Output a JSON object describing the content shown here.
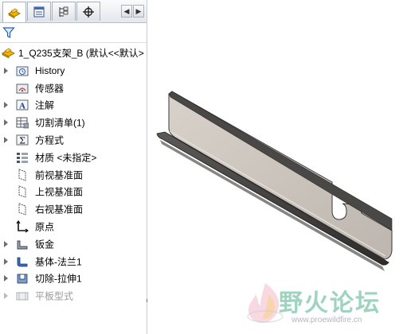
{
  "tree": {
    "root": {
      "label": "1_Q235支架_B  (默认<<默认>"
    },
    "items": [
      {
        "label": "History",
        "icon": "history-folder-icon",
        "expandable": true
      },
      {
        "label": "传感器",
        "icon": "sensor-folder-icon",
        "expandable": false
      },
      {
        "label": "注解",
        "icon": "annotation-icon",
        "expandable": true
      },
      {
        "label": "切割清单(1)",
        "icon": "cut-list-icon",
        "expandable": true
      },
      {
        "label": "方程式",
        "icon": "equation-icon",
        "expandable": true
      },
      {
        "label": "材质 <未指定>",
        "icon": "material-icon",
        "expandable": false
      },
      {
        "label": "前视基准面",
        "icon": "plane-icon",
        "expandable": false
      },
      {
        "label": "上视基准面",
        "icon": "plane-icon",
        "expandable": false
      },
      {
        "label": "右视基准面",
        "icon": "plane-icon",
        "expandable": false
      },
      {
        "label": "原点",
        "icon": "origin-icon",
        "expandable": false
      },
      {
        "label": "钣金",
        "icon": "sheet-metal-icon",
        "expandable": true
      },
      {
        "label": "基体-法兰1",
        "icon": "base-flange-icon",
        "expandable": true
      },
      {
        "label": "切除-拉伸1",
        "icon": "cut-extrude-icon",
        "expandable": true
      },
      {
        "label": "平板型式",
        "icon": "flat-pattern-icon",
        "expandable": true,
        "dimmed": true
      }
    ]
  },
  "watermark": {
    "text": "野火论坛",
    "url": "www.proewildfire.cn"
  },
  "colors": {
    "accent": "#f0b400",
    "part": "#c9c2bb",
    "watermark": "#9ed3bf"
  }
}
